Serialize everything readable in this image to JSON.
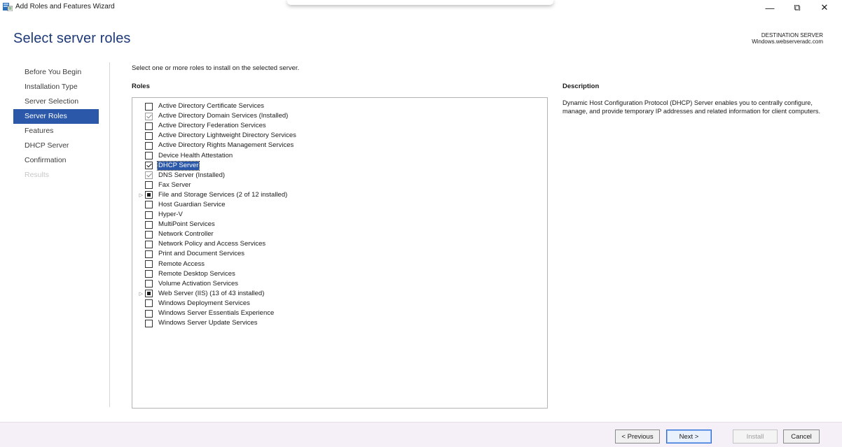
{
  "window": {
    "title": "Add Roles and Features Wizard",
    "minimize": "—",
    "restore": "⧉",
    "close": "✕"
  },
  "header": {
    "page_title": "Select server roles",
    "destination_label": "DESTINATION SERVER",
    "destination_server": "Windows.webserveradc.com"
  },
  "nav": {
    "items": [
      {
        "label": "Before You Begin",
        "state": "normal"
      },
      {
        "label": "Installation Type",
        "state": "normal"
      },
      {
        "label": "Server Selection",
        "state": "normal"
      },
      {
        "label": "Server Roles",
        "state": "active"
      },
      {
        "label": "Features",
        "state": "normal"
      },
      {
        "label": "DHCP Server",
        "state": "normal"
      },
      {
        "label": "Confirmation",
        "state": "normal"
      },
      {
        "label": "Results",
        "state": "disabled"
      }
    ]
  },
  "main": {
    "instruction": "Select one or more roles to install on the selected server.",
    "roles_heading": "Roles",
    "roles": [
      {
        "label": "Active Directory Certificate Services",
        "state": "unchecked",
        "expandable": false
      },
      {
        "label": "Active Directory Domain Services (Installed)",
        "state": "installed",
        "expandable": false
      },
      {
        "label": "Active Directory Federation Services",
        "state": "unchecked",
        "expandable": false
      },
      {
        "label": "Active Directory Lightweight Directory Services",
        "state": "unchecked",
        "expandable": false
      },
      {
        "label": "Active Directory Rights Management Services",
        "state": "unchecked",
        "expandable": false
      },
      {
        "label": "Device Health Attestation",
        "state": "unchecked",
        "expandable": false
      },
      {
        "label": "DHCP Server",
        "state": "checked",
        "expandable": false,
        "selected": true
      },
      {
        "label": "DNS Server (Installed)",
        "state": "installed",
        "expandable": false
      },
      {
        "label": "Fax Server",
        "state": "unchecked",
        "expandable": false
      },
      {
        "label": "File and Storage Services (2 of 12 installed)",
        "state": "partial",
        "expandable": true
      },
      {
        "label": "Host Guardian Service",
        "state": "unchecked",
        "expandable": false
      },
      {
        "label": "Hyper-V",
        "state": "unchecked",
        "expandable": false
      },
      {
        "label": "MultiPoint Services",
        "state": "unchecked",
        "expandable": false
      },
      {
        "label": "Network Controller",
        "state": "unchecked",
        "expandable": false
      },
      {
        "label": "Network Policy and Access Services",
        "state": "unchecked",
        "expandable": false
      },
      {
        "label": "Print and Document Services",
        "state": "unchecked",
        "expandable": false
      },
      {
        "label": "Remote Access",
        "state": "unchecked",
        "expandable": false
      },
      {
        "label": "Remote Desktop Services",
        "state": "unchecked",
        "expandable": false
      },
      {
        "label": "Volume Activation Services",
        "state": "unchecked",
        "expandable": false
      },
      {
        "label": "Web Server (IIS) (13 of 43 installed)",
        "state": "partial",
        "expandable": true
      },
      {
        "label": "Windows Deployment Services",
        "state": "unchecked",
        "expandable": false
      },
      {
        "label": "Windows Server Essentials Experience",
        "state": "unchecked",
        "expandable": false
      },
      {
        "label": "Windows Server Update Services",
        "state": "unchecked",
        "expandable": false
      }
    ]
  },
  "description": {
    "heading": "Description",
    "text": "Dynamic Host Configuration Protocol (DHCP) Server enables you to centrally configure, manage, and provide temporary IP addresses and related information for client computers."
  },
  "footer": {
    "previous": "< Previous",
    "next": "Next >",
    "install": "Install",
    "cancel": "Cancel"
  },
  "colors": {
    "accent": "#2b58a8",
    "title": "#1e3a78",
    "footer_bg": "#f5eff7"
  }
}
